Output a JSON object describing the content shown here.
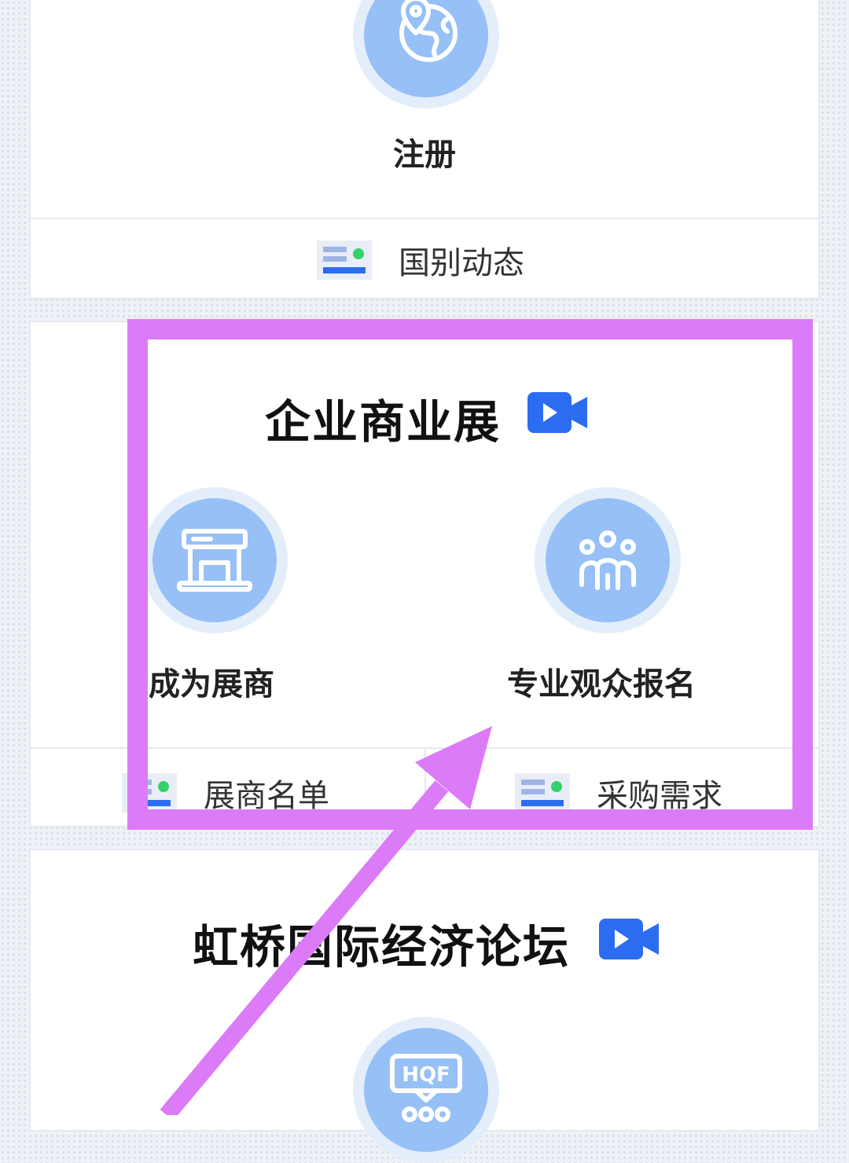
{
  "colors": {
    "page_background": "#eef2f7",
    "card_background": "#ffffff",
    "icon_circle": "#96c0f6",
    "icon_circle_halo": "#e4eefb",
    "video_icon": "#2c6cf0",
    "highlight": "#dc7bf7",
    "news_icon_bar": "#2c6cf0",
    "news_icon_dot": "#31d36a"
  },
  "top_card": {
    "icon": "globe-location-icon",
    "register_label": "注册",
    "link_icon": "news-list-icon",
    "link_label": "国别动态"
  },
  "business_exhibition_card": {
    "title": "企业商业展",
    "title_icon": "video-camera-icon",
    "items": [
      {
        "icon": "exhibition-booth-icon",
        "label": "成为展商"
      },
      {
        "icon": "audience-group-icon",
        "label": "专业观众报名"
      }
    ],
    "links": [
      {
        "icon": "news-list-icon",
        "label": "展商名单"
      },
      {
        "icon": "news-list-icon",
        "label": "采购需求"
      }
    ]
  },
  "forum_card": {
    "title": "虹桥国际经济论坛",
    "title_icon": "video-camera-icon",
    "icon": "hqf-presentation-icon",
    "icon_text": "HQF"
  },
  "annotation": {
    "highlight": "highlight-box",
    "arrow": "pointer-arrow"
  }
}
